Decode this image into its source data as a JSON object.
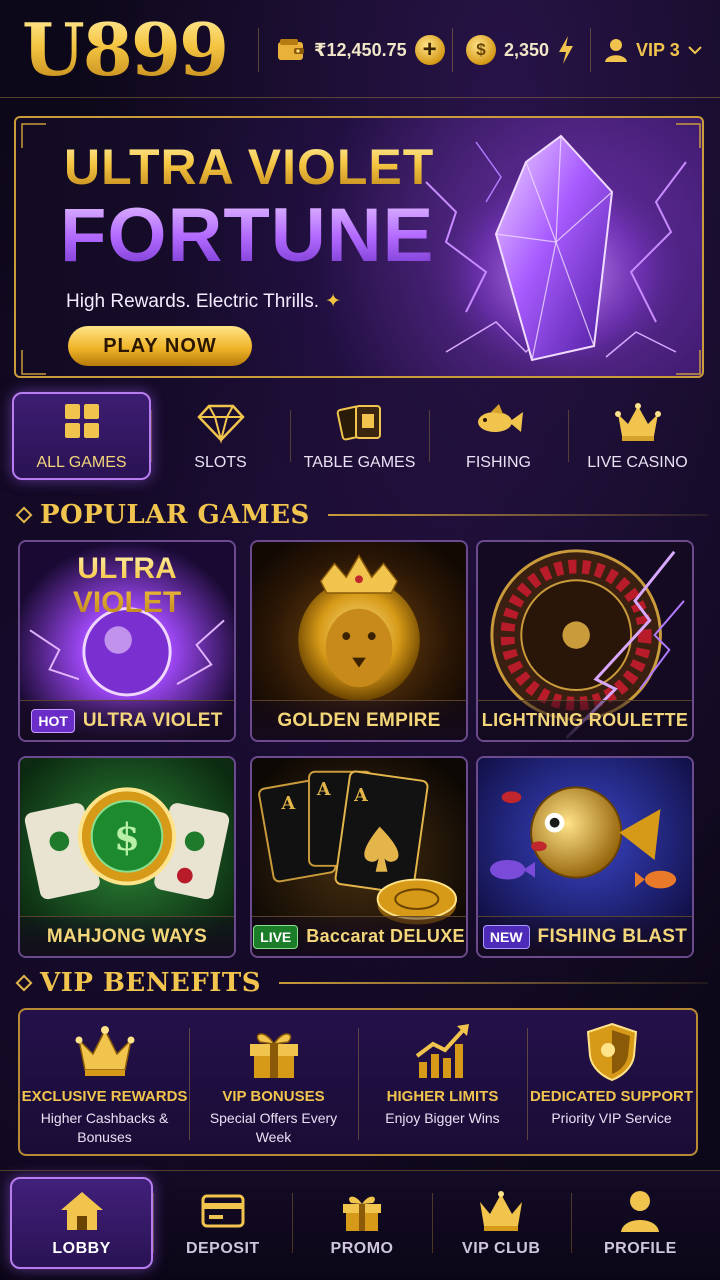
{
  "header": {
    "logo": "U899",
    "balance": "₹12,450.75",
    "coins": "2,350",
    "vip_level": "VIP 3"
  },
  "banner": {
    "title_line1": "ULTRA VIOLET",
    "title_line2": "FORTUNE",
    "subtitle": "High Rewards. Electric Thrills.",
    "cta": "PLAY NOW"
  },
  "categories": [
    {
      "label": "ALL GAMES",
      "icon": "grid-icon",
      "active": true
    },
    {
      "label": "SLOTS",
      "icon": "diamond-icon"
    },
    {
      "label": "TABLE GAMES",
      "icon": "cards-icon"
    },
    {
      "label": "FISHING",
      "icon": "fish-icon"
    },
    {
      "label": "LIVE CASINO",
      "icon": "crown-icon"
    }
  ],
  "popular": {
    "heading": "POPULAR GAMES",
    "games": [
      {
        "name": "ULTRA VIOLET",
        "art_title": "ULTRA VIOLET",
        "badge": "HOT"
      },
      {
        "name": "GOLDEN EMPIRE",
        "badge": ""
      },
      {
        "name": "LIGHTNING ROULETTE",
        "badge": ""
      },
      {
        "name": "MAHJONG WAYS",
        "badge": ""
      },
      {
        "name": "Baccarat DELUXE",
        "badge": "LIVE"
      },
      {
        "name": "FISHING BLAST",
        "badge": "NEW"
      }
    ]
  },
  "vip": {
    "heading": "VIP BENEFITS",
    "items": [
      {
        "title": "EXCLUSIVE REWARDS",
        "desc": "Higher Cashbacks & Bonuses",
        "icon": "crown-icon"
      },
      {
        "title": "VIP BONUSES",
        "desc": "Special Offers Every Week",
        "icon": "gift-icon"
      },
      {
        "title": "HIGHER LIMITS",
        "desc": "Enjoy Bigger Wins",
        "icon": "chart-icon"
      },
      {
        "title": "DEDICATED SUPPORT",
        "desc": "Priority VIP Service",
        "icon": "shield-icon"
      }
    ]
  },
  "nav": [
    {
      "label": "LOBBY",
      "icon": "home-icon",
      "active": true
    },
    {
      "label": "DEPOSIT",
      "icon": "card-icon"
    },
    {
      "label": "PROMO",
      "icon": "gift-icon"
    },
    {
      "label": "VIP CLUB",
      "icon": "crown-icon"
    },
    {
      "label": "PROFILE",
      "icon": "user-icon"
    }
  ],
  "colors": {
    "background": "#0d0819",
    "gold": "#f1c44e",
    "violet_accent": "#b77df0"
  }
}
